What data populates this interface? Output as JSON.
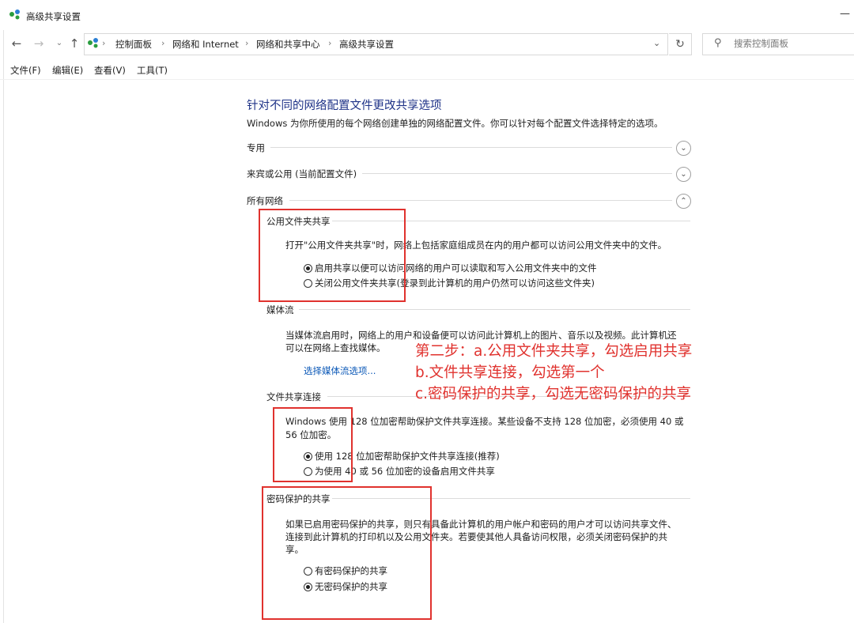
{
  "window": {
    "title": "高级共享设置"
  },
  "address": {
    "crumbs": [
      "控制面板",
      "网络和 Internet",
      "网络和共享中心",
      "高级共享设置"
    ],
    "search_placeholder": "搜索控制面板"
  },
  "menu": [
    "文件(F)",
    "编辑(E)",
    "查看(V)",
    "工具(T)"
  ],
  "content": {
    "heading": "针对不同的网络配置文件更改共享选项",
    "description": "Windows 为你所使用的每个网络创建单独的网络配置文件。你可以针对每个配置文件选择特定的选项。",
    "profiles": [
      {
        "label": "专用",
        "state": "collapsed"
      },
      {
        "label": "来宾或公用 (当前配置文件)",
        "state": "collapsed"
      },
      {
        "label": "所有网络",
        "state": "expanded"
      }
    ],
    "public_folder": {
      "title": "公用文件夹共享",
      "text": "打开\"公用文件夹共享\"时，网络上包括家庭组成员在内的用户都可以访问公用文件夹中的文件。",
      "options": [
        {
          "label": "启用共享以便可以访问网络的用户可以读取和写入公用文件夹中的文件",
          "selected": true
        },
        {
          "label": "关闭公用文件夹共享(登录到此计算机的用户仍然可以访问这些文件夹)",
          "selected": false
        }
      ]
    },
    "media": {
      "title": "媒体流",
      "text_line1": "当媒体流启用时，网络上的用户和设备便可以访问此计算机上的图片、音乐以及视频。此计算机还",
      "text_line2": "可以在网络上查找媒体。",
      "link": "选择媒体流选项..."
    },
    "file_sharing": {
      "title": "文件共享连接",
      "text_line1": "Windows 使用 128 位加密帮助保护文件共享连接。某些设备不支持 128 位加密，必须使用 40 或",
      "text_line2": "56 位加密。",
      "options": [
        {
          "label": "使用 128 位加密帮助保护文件共享连接(推荐)",
          "selected": true
        },
        {
          "label": "为使用 40 或 56 位加密的设备启用文件共享",
          "selected": false
        }
      ]
    },
    "password": {
      "title": "密码保护的共享",
      "text_line1": "如果已启用密码保护的共享，则只有具备此计算机的用户帐户和密码的用户才可以访问共享文件、",
      "text_line2": "连接到此计算机的打印机以及公用文件夹。若要使其他人具备访问权限，必须关闭密码保护的共",
      "text_line3": "享。",
      "options": [
        {
          "label": "有密码保护的共享",
          "selected": false
        },
        {
          "label": "无密码保护的共享",
          "selected": true
        }
      ]
    }
  },
  "annotation": {
    "line1": "第二步：a.公用文件夹共享，勾选启用共享",
    "line2": "b.文件共享连接，勾选第一个",
    "line3": "c.密码保护的共享，勾选无密码保护的共享",
    "color": "#e0322e"
  }
}
